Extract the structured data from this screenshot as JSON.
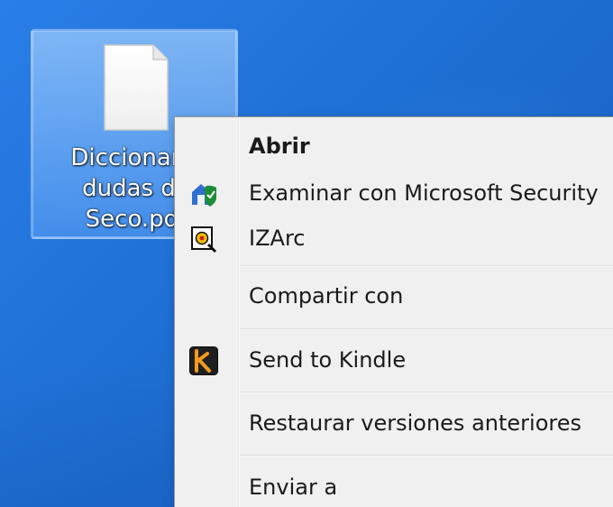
{
  "desktop": {
    "file_item": {
      "label_lines": [
        "Diccionario",
        "dudas de",
        "Seco.pdf"
      ],
      "icon_name": "document-icon"
    }
  },
  "context_menu": {
    "items": [
      {
        "label": "Abrir",
        "icon": "",
        "bold": true
      },
      {
        "label": "Examinar con Microsoft Security",
        "icon": "microsoft-security-icon"
      },
      {
        "label": "IZArc",
        "icon": "izarc-icon"
      },
      {
        "label": "Compartir con",
        "icon": ""
      },
      {
        "label": "Send to Kindle",
        "icon": "kindle-icon"
      },
      {
        "label": "Restaurar versiones anteriores",
        "icon": ""
      },
      {
        "label": "Enviar a",
        "icon": ""
      }
    ]
  },
  "colors": {
    "desktop_blue": "#1e6fd3",
    "menu_bg": "#f0f0f0",
    "menu_border": "#979797",
    "selection": "#9fcbff"
  }
}
